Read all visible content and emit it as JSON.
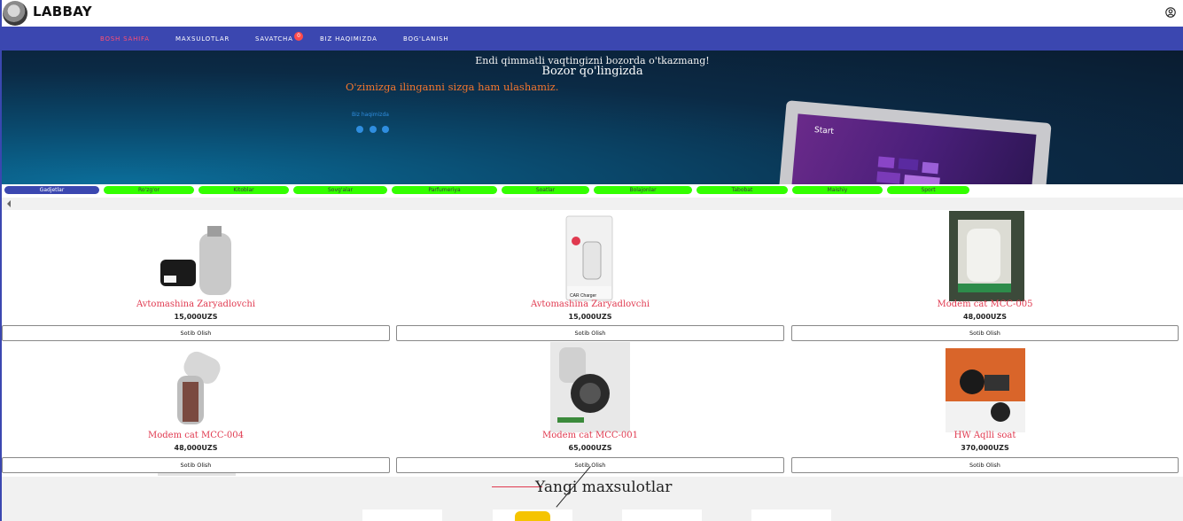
{
  "header": {
    "brand": "LABBAY",
    "user_icon": "user-circle-icon"
  },
  "nav": {
    "items": [
      {
        "label": "BOSH SAHIFA",
        "active": true
      },
      {
        "label": "MAXSULOTLAR",
        "active": false
      },
      {
        "label": "SAVATCHA",
        "active": false,
        "badge": "0"
      },
      {
        "label": "BIZ HAQIMIZDA",
        "active": false
      },
      {
        "label": "BOG'LANISH",
        "active": false
      }
    ]
  },
  "hero": {
    "line1": "Endi qimmatli vaqtingizni bozorda o'tkazmang!",
    "line2": "Bozor qo'lingizda",
    "line3": "O'zimizga ilinganni sizga ham ulashamiz.",
    "link": "Biz haqimizda",
    "social": [
      "facebook-icon",
      "instagram-icon",
      "telegram-icon"
    ],
    "screen_text": "Start"
  },
  "categories": [
    {
      "label": "Gadjetlar",
      "active": true
    },
    {
      "label": "Ro'zg'or",
      "active": false
    },
    {
      "label": "Kitoblar",
      "active": false
    },
    {
      "label": "Sovg'alar",
      "active": false
    },
    {
      "label": "Parfumeriya",
      "active": false
    },
    {
      "label": "Soatlar",
      "active": false
    },
    {
      "label": "Bolajonlar",
      "active": false
    },
    {
      "label": "Tabobat",
      "active": false
    },
    {
      "label": "Maishiy",
      "active": false
    },
    {
      "label": "Sport",
      "active": false
    }
  ],
  "products": [
    {
      "name": "Avtomashina Zaryadlovchi",
      "price": "15,000UZS",
      "button": "Sotib Olish"
    },
    {
      "name": "Avtomashina Zaryadlovchi",
      "price": "15,000UZS",
      "button": "Sotib Olish"
    },
    {
      "name": "Modem cat MCC-005",
      "price": "48,000UZS",
      "button": "Sotib Olish"
    },
    {
      "name": "Modem cat MCC-004",
      "price": "48,000UZS",
      "button": "Sotib Olish"
    },
    {
      "name": "Modem cat MCC-001",
      "price": "65,000UZS",
      "button": "Sotib Olish"
    },
    {
      "name": "HW Aqlli soat",
      "price": "370,000UZS",
      "button": "Sotib Olish"
    }
  ],
  "box_label": "CAR Charger",
  "new_section": {
    "title": "Yangi maxsulotlar"
  },
  "colors": {
    "nav": "#3b47b0",
    "accent": "#e0394f",
    "category": "#33ff00",
    "hero_text": "#f2752e"
  }
}
